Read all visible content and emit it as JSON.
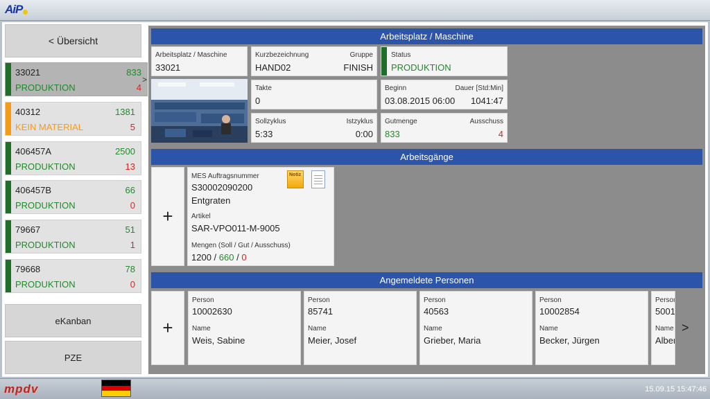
{
  "app": {
    "logo": "AiP",
    "vendor": "mpdv",
    "clock": "15.09.15 15:47:46"
  },
  "left": {
    "overview": "< Übersicht",
    "machines": [
      {
        "id": "33021",
        "qty": "833",
        "status": "PRODUKTION",
        "scrap": "4",
        "color": "#1f6e2a"
      },
      {
        "id": "40312",
        "qty": "1381",
        "status": "KEIN MATERIAL",
        "scrap": "5",
        "color": "#f39c1a"
      },
      {
        "id": "406457A",
        "qty": "2500",
        "status": "PRODUKTION",
        "scrap": "13",
        "color": "#1f6e2a"
      },
      {
        "id": "406457B",
        "qty": "66",
        "status": "PRODUKTION",
        "scrap": "0",
        "color": "#1f6e2a"
      },
      {
        "id": "79667",
        "qty": "51",
        "status": "PRODUKTION",
        "scrap": "1",
        "color": "#1f6e2a"
      },
      {
        "id": "79668",
        "qty": "78",
        "status": "PRODUKTION",
        "scrap": "0",
        "color": "#1f6e2a"
      }
    ],
    "active_marker": ">",
    "ekanban": "eKanban",
    "pze": "PZE"
  },
  "workplace": {
    "header": "Arbeitsplatz / Maschine",
    "ap_label": "Arbeitsplatz / Maschine",
    "ap_value": "33021",
    "short_label": "Kurzbezeichnung",
    "short_value": "HAND02",
    "group_label": "Gruppe",
    "group_value": "FINISH",
    "status_label": "Status",
    "status_value": "PRODUKTION",
    "takte_label": "Takte",
    "takte_value": "0",
    "begin_label": "Beginn",
    "begin_value": "03.08.2015  06:00",
    "duration_label": "Dauer [Std:Min]",
    "duration_value": "1041:47",
    "soll_label": "Sollzyklus",
    "soll_value": "5:33",
    "ist_label": "Istzyklus",
    "ist_value": "0:00",
    "good_label": "Gutmenge",
    "good_value": "833",
    "scrap_label": "Ausschuss",
    "scrap_value": "4"
  },
  "operations": {
    "header": "Arbeitsgänge",
    "add": "+",
    "order_label": "MES Auftragsnummer",
    "order_value": "S30002090200",
    "op_name": "Entgraten",
    "article_label": "Artikel",
    "article_value": "SAR-VPO011-M-9005",
    "qty_label": "Mengen (Soll / Gut / Ausschuss)",
    "qty_target": "1200",
    "qty_good": "660",
    "qty_scrap": "0",
    "sep": "/",
    "note_icon_text": "Notiz"
  },
  "persons": {
    "header": "Angemeldete Personen",
    "add": "+",
    "person_label": "Person",
    "name_label": "Name",
    "list": [
      {
        "id": "10002630",
        "name": "Weis, Sabine"
      },
      {
        "id": "85741",
        "name": "Meier, Josef"
      },
      {
        "id": "40563",
        "name": "Grieber, Maria"
      },
      {
        "id": "10002854",
        "name": "Becker, Jürgen"
      },
      {
        "id": "5001",
        "name": "Alber"
      }
    ],
    "next": ">"
  }
}
